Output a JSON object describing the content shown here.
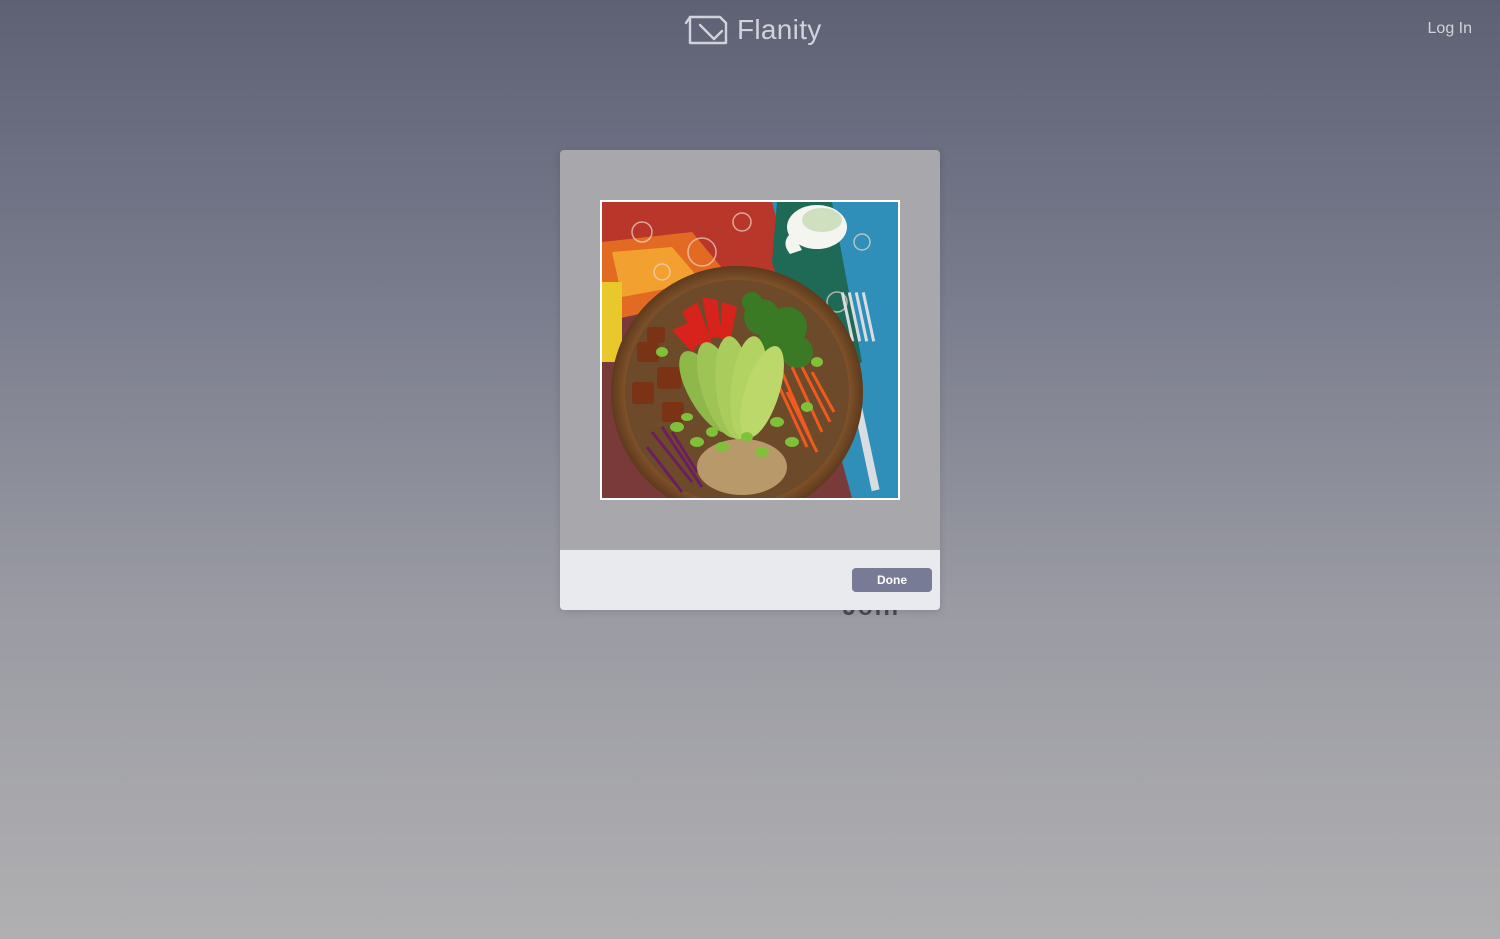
{
  "header": {
    "brand_name": "Flanity",
    "login_label": "Log In",
    "logo_icon": "flanity-logo-icon"
  },
  "background_card": {
    "partial_text": "Join"
  },
  "modal": {
    "image_alt_icon": "food-bowl-photo",
    "done_label": "Done"
  },
  "colors": {
    "accent": "#787b96",
    "footer_bg": "#e9eaee",
    "modal_bg": "#a8a8ac"
  }
}
